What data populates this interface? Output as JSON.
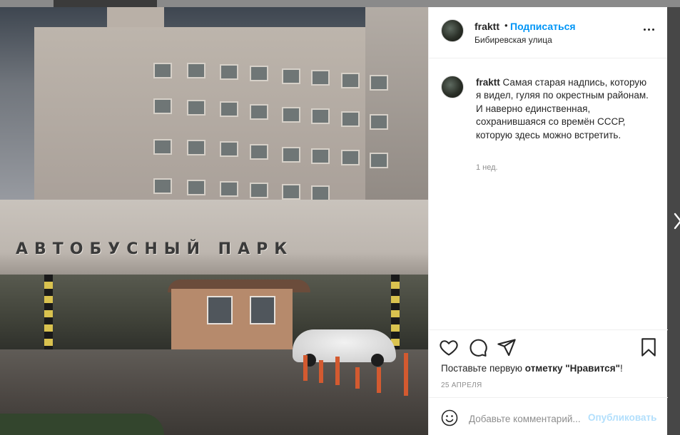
{
  "post": {
    "username": "fraktt",
    "separator": "•",
    "follow_label": "Подписаться",
    "location": "Бибиревская улица",
    "sign_text": "АВТОБУСНЫЙ ПАРК"
  },
  "caption": {
    "username": "fraktt",
    "text": "Самая старая надпись, которую я видел, гуляя по окрестным районам. И наверно единственная, сохранившаяся со времён СССР, которую здесь можно встретить.",
    "time": "1 нед."
  },
  "actions": {
    "like_prefix": "Поставьте первую ",
    "like_link": "отметку \"Нравится\"",
    "like_suffix": "!",
    "date": "25 АПРЕЛЯ"
  },
  "comment": {
    "placeholder": "Добавьте комментарий...",
    "publish_label": "Опубликовать"
  },
  "icons": {
    "like": "heart-icon",
    "comment": "comment-icon",
    "share": "paper-plane-icon",
    "save": "bookmark-icon",
    "emoji": "smile-icon",
    "more": "more-options-icon",
    "next": "chevron-right-icon"
  },
  "colors": {
    "accent": "#0095f6",
    "publish_disabled": "#b2dffc",
    "text": "#262626",
    "secondary": "#8e8e8e"
  }
}
